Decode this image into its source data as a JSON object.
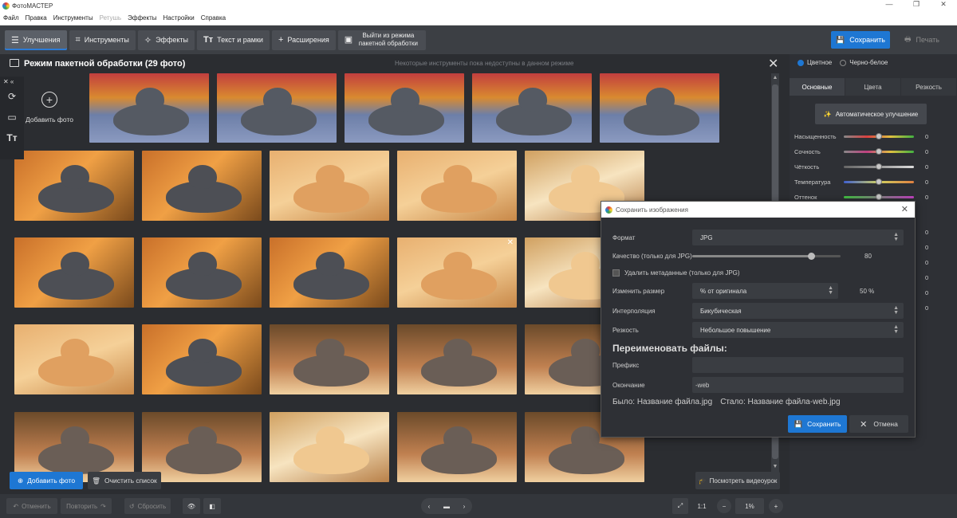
{
  "app": {
    "title": "ФотоМАСТЕР",
    "window_controls": [
      "—",
      "❐",
      "✕"
    ]
  },
  "menu": [
    "Файл",
    "Правка",
    "Инструменты",
    "Ретушь",
    "Эффекты",
    "Настройки",
    "Справка"
  ],
  "menu_disabled_index": 3,
  "toolbar": {
    "tabs": [
      {
        "label": "Улучшения",
        "icon": "sliders-icon"
      },
      {
        "label": "Инструменты",
        "icon": "crop-icon"
      },
      {
        "label": "Эффекты",
        "icon": "sparkle-icon"
      },
      {
        "label": "Текст и рамки",
        "icon": "text-icon"
      },
      {
        "label": "Расширения",
        "icon": "plus-icon"
      }
    ],
    "exit_batch_line1": "Выйти из режима",
    "exit_batch_line2": "пакетной обработки",
    "save_label": "Сохранить",
    "print_label": "Печать"
  },
  "batch": {
    "title": "Режим пакетной обработки (29 фото)",
    "note": "Некоторые инструменты пока недоступны в данном режиме",
    "add_photo_tile": "Добавить фото"
  },
  "bottom": {
    "add_photo": "Добавить фото",
    "clear_list": "Очистить список",
    "video": "Посмотреть видеоурок"
  },
  "footer": {
    "undo": "Отменить",
    "redo": "Повторить",
    "reset": "Сбросить",
    "ratio": "1:1",
    "zoom": "1%"
  },
  "right_panel": {
    "color_mode": "Цветное",
    "bw_mode": "Черно-белое",
    "tabs": [
      "Основные",
      "Цвета",
      "Резкость"
    ],
    "auto_button": "Автоматическое улучшение",
    "sliders": [
      {
        "label": "Насыщенность",
        "value": "0"
      },
      {
        "label": "Сочность",
        "value": "0"
      },
      {
        "label": "Чёткость",
        "value": "0"
      },
      {
        "label": "Температура",
        "value": "0"
      },
      {
        "label": "Оттенок",
        "value": "0"
      }
    ],
    "extra_values": [
      "0",
      "0",
      "0",
      "0",
      "0",
      "0"
    ]
  },
  "dialog": {
    "title": "Сохранить изображения",
    "format_label": "Формат",
    "format_value": "JPG",
    "quality_label": "Качество (только для JPG)",
    "quality_value": "80",
    "quality_fraction": 0.8,
    "remove_meta_label": "Удалить метаданные (только для JPG)",
    "resize_label": "Изменить размер",
    "resize_value": "% от оригинала",
    "resize_percent": "50 %",
    "interp_label": "Интерполяция",
    "interp_value": "Бикубическая",
    "sharp_label": "Резкость",
    "sharp_value": "Небольшое повышение",
    "rename_heading": "Переименовать файлы:",
    "prefix_label": "Префикс",
    "prefix_value": "",
    "suffix_label": "Окончание",
    "suffix_value": "-web",
    "was_text": "Было: Название файла.jpg",
    "became_text": "Стало: Название файла-web.jpg",
    "save_button": "Сохранить",
    "cancel_button": "Отмена"
  },
  "colors": {
    "accent": "#1e77d3",
    "bg": "#2b2d31",
    "panel": "#2e3035"
  }
}
